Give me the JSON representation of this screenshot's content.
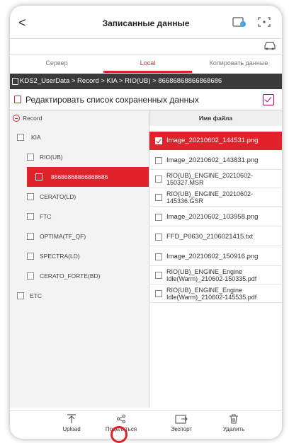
{
  "header": {
    "back_glyph": "<",
    "title": "Записанные данные"
  },
  "tabs": [
    {
      "label": "Сервер",
      "active": false
    },
    {
      "label": "Local",
      "active": true
    },
    {
      "label": "Копировать данные",
      "active": false
    }
  ],
  "breadcrumb": "KDS2_UserData > Record > KIA > RIO(UB) > 86686868866868686",
  "edit_saved_list_label": "Редактировать список сохраненных данных",
  "tree": {
    "root": "Record",
    "items": [
      {
        "label": "KIA",
        "level": 1,
        "selected": false
      },
      {
        "label": "RIO(UB)",
        "level": 2,
        "selected": false
      },
      {
        "label": "86686868866868686",
        "level": 3,
        "selected": true
      },
      {
        "label": "CERATO(LD)",
        "level": 2,
        "selected": false
      },
      {
        "label": "FTC",
        "level": 2,
        "selected": false
      },
      {
        "label": "OPTIMA(TF_QF)",
        "level": 2,
        "selected": false
      },
      {
        "label": "SPECTRA(LD)",
        "level": 2,
        "selected": false
      },
      {
        "label": "CERATO_FORTE(BD)",
        "level": 2,
        "selected": false
      },
      {
        "label": "ETC",
        "level": 1,
        "selected": false
      }
    ]
  },
  "files": {
    "header": "Имя файла",
    "items": [
      {
        "name": "Image_20210602_144531.png",
        "selected": true
      },
      {
        "name": "Image_20210602_143831.png",
        "selected": false
      },
      {
        "name": "RIO(UB)_ENGINE_20210602-150327.MSR",
        "selected": false
      },
      {
        "name": "RIO(UB)_ENGINE_20210602-145336.GSR",
        "selected": false
      },
      {
        "name": "Image_20210602_103958.png",
        "selected": false
      },
      {
        "name": "FFD_P0630_2106021415.txt",
        "selected": false
      },
      {
        "name": "Image_20210602_150916.png",
        "selected": false
      },
      {
        "name": "RIO(UB)_ENGINE_Engine Idle(Warm)_210602-150335.pdf",
        "selected": false
      },
      {
        "name": "RIO(UB)_ENGINE_Engine Idle(Warm)_210602-145535.pdf",
        "selected": false
      }
    ]
  },
  "bottom_bar": {
    "upload": "Upload",
    "share": "Поделиться",
    "export": "Экспорт",
    "delete": "Удалить"
  },
  "colors": {
    "accent": "#e0222b",
    "breadcrumb_bg": "#3a3a3a",
    "tree_bg": "#f3f3f3"
  },
  "icons": [
    "back-icon",
    "storage-icon",
    "screen-capture-icon",
    "car-icon",
    "folder-icon",
    "edit-list-icon",
    "upload-icon",
    "share-icon",
    "export-icon",
    "trash-icon"
  ]
}
